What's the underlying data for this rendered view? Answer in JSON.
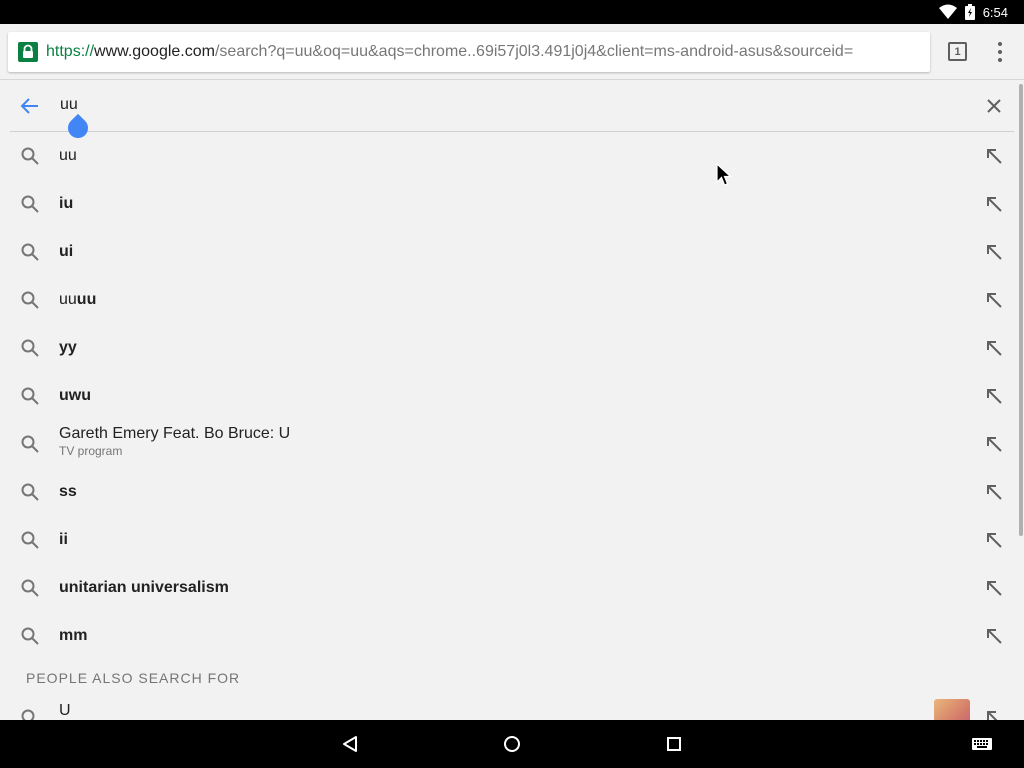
{
  "status_bar": {
    "time": "6:54",
    "icons": [
      "wifi-icon",
      "battery-icon"
    ]
  },
  "omnibox": {
    "scheme": "https://",
    "host": "www.google.com",
    "path": "/search?q=uu&oq=uu&aqs=chrome..69i57j0l3.491j0j4&client=ms-android-asus&sourceid=",
    "secure": true
  },
  "toolbar": {
    "tab_count": "1"
  },
  "search": {
    "query": "uu"
  },
  "suggestions": [
    {
      "plain": "uu",
      "bold": ""
    },
    {
      "plain": "",
      "bold": "iu"
    },
    {
      "plain": "",
      "bold": "ui"
    },
    {
      "plain": "uu",
      "bold": "uu"
    },
    {
      "plain": "",
      "bold": "yy"
    },
    {
      "plain": "",
      "bold": "uwu"
    },
    {
      "title": "Gareth Emery Feat. Bo Bruce: U",
      "subtitle": "TV program"
    },
    {
      "plain": "",
      "bold": "ss"
    },
    {
      "plain": "",
      "bold": "ii"
    },
    {
      "plain": "",
      "bold": "unitarian universalism"
    },
    {
      "plain": "",
      "bold": "mm"
    }
  ],
  "people_also_search": {
    "header": "PEOPLE ALSO SEARCH FOR",
    "items": [
      {
        "text": "U"
      }
    ]
  },
  "colors": {
    "accent": "#4285f4",
    "secure_green": "#0b8043",
    "background": "#f2f2f2"
  }
}
